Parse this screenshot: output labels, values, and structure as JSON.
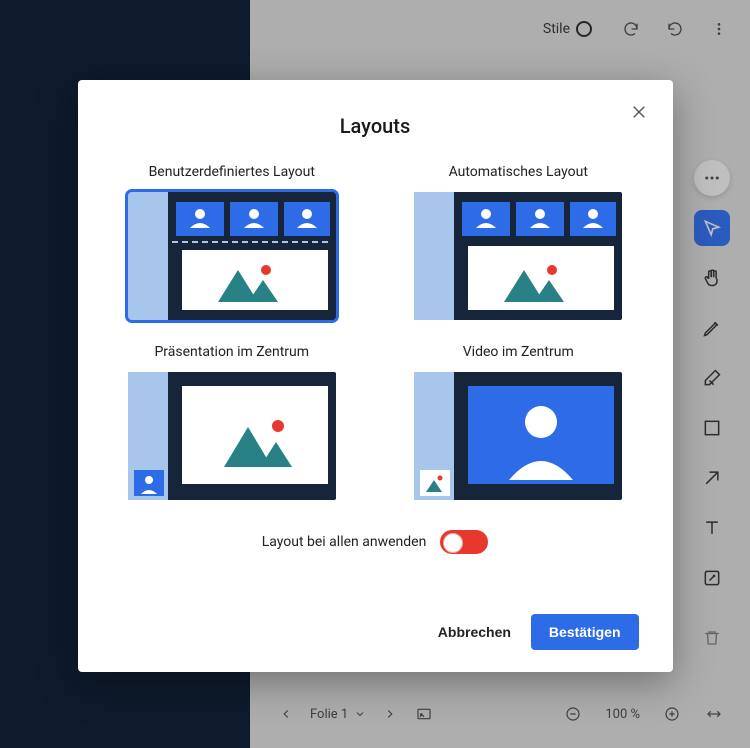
{
  "topbar": {
    "stile_label": "Stile"
  },
  "modal": {
    "title": "Layouts",
    "layouts": [
      {
        "label": "Benutzerdefiniertes Layout",
        "selected": true
      },
      {
        "label": "Automatisches Layout",
        "selected": false
      },
      {
        "label": "Präsentation im Zentrum",
        "selected": false
      },
      {
        "label": "Video im Zentrum",
        "selected": false
      }
    ],
    "apply_all_label": "Layout bei allen anwenden",
    "apply_all_value": false,
    "cancel_label": "Abbrechen",
    "confirm_label": "Bestätigen"
  },
  "bottombar": {
    "slide_label": "Folie 1",
    "zoom": "100 %"
  },
  "colors": {
    "brand_blue": "#2e6be6",
    "accent_blue": "#3a7afe",
    "navy": "#16253a",
    "light_blue": "#a8c5eb",
    "teal": "#288185",
    "red_dot": "#e6382e"
  }
}
